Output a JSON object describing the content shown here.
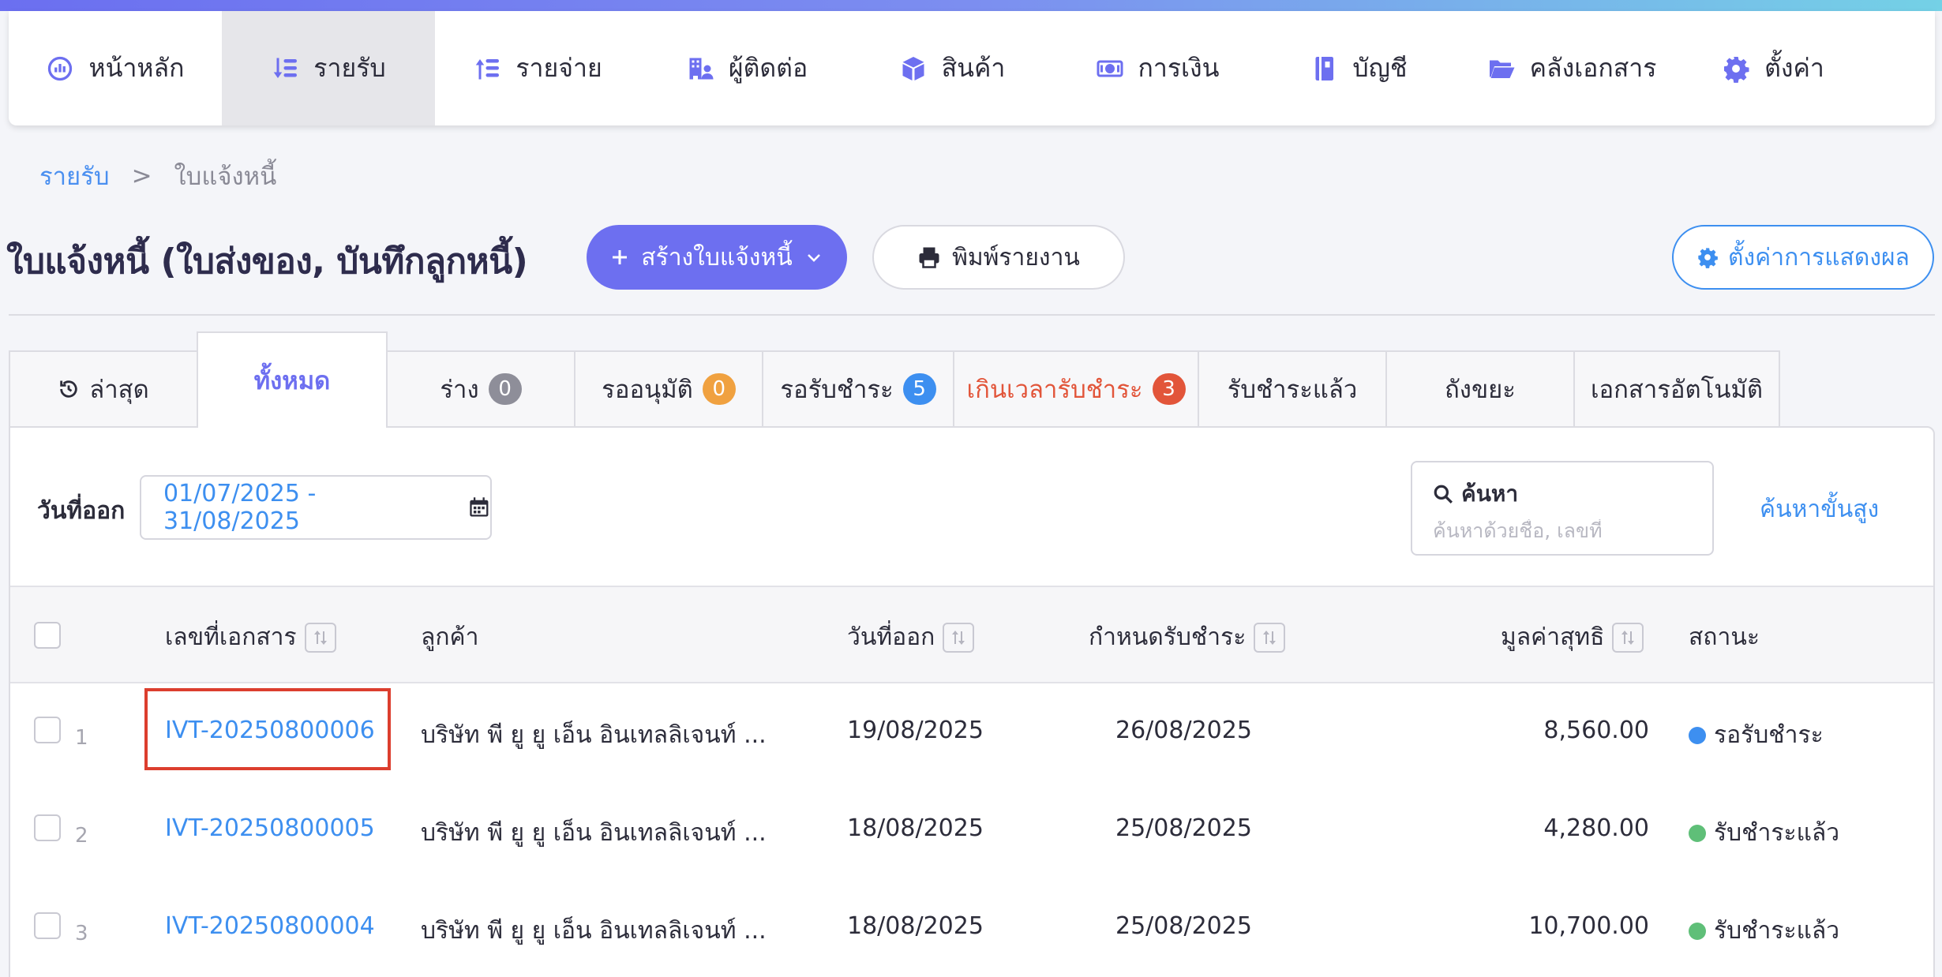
{
  "nav": {
    "items": [
      {
        "label": "หน้าหลัก",
        "icon": "dashboard-icon"
      },
      {
        "label": "รายรับ",
        "icon": "income-icon"
      },
      {
        "label": "รายจ่าย",
        "icon": "expense-icon"
      },
      {
        "label": "ผู้ติดต่อ",
        "icon": "contacts-icon"
      },
      {
        "label": "สินค้า",
        "icon": "product-box-icon"
      },
      {
        "label": "การเงิน",
        "icon": "money-icon"
      },
      {
        "label": "บัญชี",
        "icon": "accounting-book-icon"
      },
      {
        "label": "คลังเอกสาร",
        "icon": "folder-icon"
      },
      {
        "label": "ตั้งค่า",
        "icon": "gear-icon"
      }
    ],
    "active_index": 1
  },
  "breadcrumb": {
    "parent": "รายรับ",
    "separator": ">",
    "current": "ใบแจ้งหนี้"
  },
  "page": {
    "title": "ใบแจ้งหนี้ (ใบส่งของ, บันทึกลูกหนี้)"
  },
  "actions": {
    "create_label": "สร้างใบแจ้งหนี้",
    "print_label": "พิมพ์รายงาน",
    "display_settings_label": "ตั้งค่าการแสดงผล"
  },
  "tabs": [
    {
      "label": "ล่าสุด"
    },
    {
      "label": "ทั้งหมด"
    },
    {
      "label": "ร่าง",
      "count": "0",
      "badge_color": "#8e8e99"
    },
    {
      "label": "รออนุมัติ",
      "count": "0",
      "badge_color": "#f0a140"
    },
    {
      "label": "รอรับชำระ",
      "count": "5",
      "badge_color": "#3d8ff0"
    },
    {
      "label": "เกินเวลารับชำระ",
      "count": "3",
      "badge_color": "#e2553a"
    },
    {
      "label": "รับชำระแล้ว"
    },
    {
      "label": "ถังขยะ"
    },
    {
      "label": "เอกสารอัตโนมัติ"
    }
  ],
  "filters": {
    "date_label": "วันที่ออก",
    "date_range": "01/07/2025 - 31/08/2025",
    "search_title": "ค้นหา",
    "search_placeholder": "ค้นหาด้วยชื่อ, เลขที่",
    "advanced_search_label": "ค้นหาขั้นสูง"
  },
  "table": {
    "columns": {
      "doc_no": "เลขที่เอกสาร",
      "customer": "ลูกค้า",
      "issue_date": "วันที่ออก",
      "due_date": "กำหนดรับชำระ",
      "net_value": "มูลค่าสุทธิ",
      "status": "สถานะ"
    },
    "rows": [
      {
        "num": "1",
        "doc_no": "IVT-20250800006",
        "customer": "บริษัท พี ยู ยู เอ็น อินเทลลิเจนท์ ...",
        "issue_date": "19/08/2025",
        "due_date": "26/08/2025",
        "net_value": "8,560.00",
        "status": "รอรับชำระ",
        "status_color": "#3d8ff0"
      },
      {
        "num": "2",
        "doc_no": "IVT-20250800005",
        "customer": "บริษัท พี ยู ยู เอ็น อินเทลลิเจนท์ ...",
        "issue_date": "18/08/2025",
        "due_date": "25/08/2025",
        "net_value": "4,280.00",
        "status": "รับชำระแล้ว",
        "status_color": "#5fbf78"
      },
      {
        "num": "3",
        "doc_no": "IVT-20250800004",
        "customer": "บริษัท พี ยู ยู เอ็น อินเทลลิเจนท์ ...",
        "issue_date": "18/08/2025",
        "due_date": "25/08/2025",
        "net_value": "10,700.00",
        "status": "รับชำระแล้ว",
        "status_color": "#5fbf78"
      }
    ]
  },
  "colors": {
    "accent": "#6d6ff0",
    "link": "#3d8ff0",
    "overdue": "#e2553a",
    "highlight_box": "#dc3e2e"
  }
}
